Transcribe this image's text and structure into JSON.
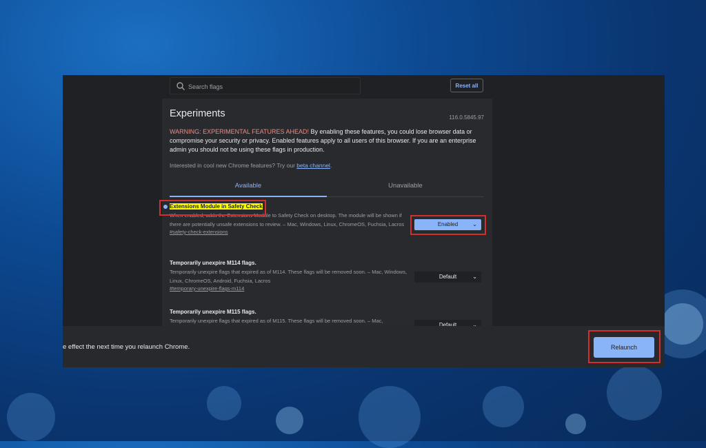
{
  "search": {
    "placeholder": "Search flags"
  },
  "header": {
    "reset_label": "Reset all"
  },
  "page": {
    "title": "Experiments",
    "version": "116.0.5845.97",
    "warning_prefix": "WARNING: EXPERIMENTAL FEATURES AHEAD!",
    "warning_body": " By enabling these features, you could lose browser data or compromise your security or privacy. Enabled features apply to all users of this browser. If you are an enterprise admin you should not be using these flags in production.",
    "interest_text": "Interested in cool new Chrome features? Try our ",
    "interest_link": "beta channel",
    "interest_end": "."
  },
  "tabs": {
    "available": "Available",
    "unavailable": "Unavailable"
  },
  "flags": [
    {
      "name": "Extensions Module in Safety Check",
      "description": "When enabled, adds the Extensions Module to Safety Check on desktop. The module will be shown if there are potentially unsafe extensions to review. – Mac, Windows, Linux, ChromeOS, Fuchsia, Lacros",
      "link": "#safety-check-extensions",
      "value": "Enabled"
    },
    {
      "name": "Temporarily unexpire M114 flags.",
      "description": "Temporarily unexpire flags that expired as of M114. These flags will be removed soon. – Mac, Windows, Linux, ChromeOS, Android, Fuchsia, Lacros",
      "link": "#temporary-unexpire-flags-m114",
      "value": "Default"
    },
    {
      "name": "Temporarily unexpire M115 flags.",
      "description": "Temporarily unexpire flags that expired as of M115. These flags will be removed soon. – Mac,",
      "value": "Default"
    }
  ],
  "bottom": {
    "message": "e effect the next time you relaunch Chrome.",
    "relaunch_label": "Relaunch"
  },
  "colors": {
    "accent": "#8ab4f8",
    "highlight": "#ffff00",
    "annotation_red": "#d32f2f",
    "background": "#202124"
  }
}
